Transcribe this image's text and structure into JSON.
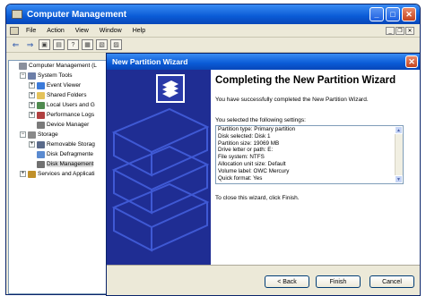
{
  "main_window": {
    "title": "Computer Management",
    "menu": [
      "File",
      "Action",
      "View",
      "Window",
      "Help"
    ],
    "mdi_buttons": [
      "_",
      "❐",
      "✕"
    ]
  },
  "tree": [
    {
      "label": "Computer Management (L",
      "level": 0,
      "expander": "",
      "icon": "computer-icon"
    },
    {
      "label": "System Tools",
      "level": 1,
      "expander": "−",
      "icon": "tools-icon"
    },
    {
      "label": "Event Viewer",
      "level": 2,
      "expander": "+",
      "icon": "event-viewer-icon"
    },
    {
      "label": "Shared Folders",
      "level": 2,
      "expander": "+",
      "icon": "folder-icon"
    },
    {
      "label": "Local Users and G",
      "level": 2,
      "expander": "+",
      "icon": "users-icon"
    },
    {
      "label": "Performance Logs",
      "level": 2,
      "expander": "+",
      "icon": "performance-icon"
    },
    {
      "label": "Device Manager",
      "level": 2,
      "expander": "",
      "icon": "device-manager-icon"
    },
    {
      "label": "Storage",
      "level": 1,
      "expander": "−",
      "icon": "storage-icon"
    },
    {
      "label": "Removable Storag",
      "level": 2,
      "expander": "+",
      "icon": "removable-storage-icon"
    },
    {
      "label": "Disk Defragmente",
      "level": 2,
      "expander": "",
      "icon": "defrag-icon"
    },
    {
      "label": "Disk Management",
      "level": 2,
      "expander": "",
      "icon": "disk-management-icon",
      "selected": true
    },
    {
      "label": "Services and Applicati",
      "level": 1,
      "expander": "+",
      "icon": "services-icon"
    }
  ],
  "wizard": {
    "title": "New Partition Wizard",
    "heading": "Completing the New Partition Wizard",
    "message": "You have successfully completed the New Partition Wizard.",
    "settings_label": "You selected the following settings:",
    "settings": [
      "Partition type: Primary partition",
      "Disk selected: Disk 1",
      "Partition size: 19069 MB",
      "Drive letter or path: E:",
      "File system: NTFS",
      "Allocation unit size: Default",
      "Volume label: OWC Mercury",
      "Quick format: Yes"
    ],
    "finish_hint": "To close this wizard, click Finish.",
    "buttons": {
      "back": "< Back",
      "finish": "Finish",
      "cancel": "Cancel"
    }
  },
  "colors": {
    "titlebar": "#0a5bd6",
    "wizard_side": "#1f2d93",
    "face": "#ece9d8"
  }
}
